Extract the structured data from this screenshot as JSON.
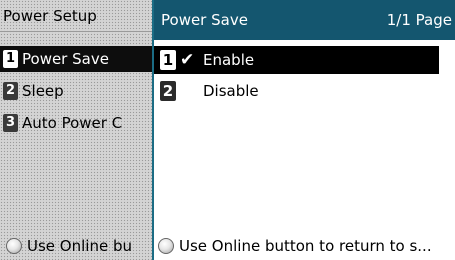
{
  "left_menu": {
    "header": "Power Setup",
    "items": [
      {
        "num": "1",
        "label": "Power Save"
      },
      {
        "num": "2",
        "label": "Sleep"
      },
      {
        "num": "3",
        "label": "Auto Power C"
      }
    ],
    "footer": "Use Online bu"
  },
  "panel": {
    "title": "Power Save",
    "page": "1/1 Page",
    "options": [
      {
        "num": "1",
        "check": "✔",
        "label": "Enable"
      },
      {
        "num": "2",
        "check": "",
        "label": "Disable"
      }
    ],
    "footer": "Use Online button to return to s..."
  }
}
